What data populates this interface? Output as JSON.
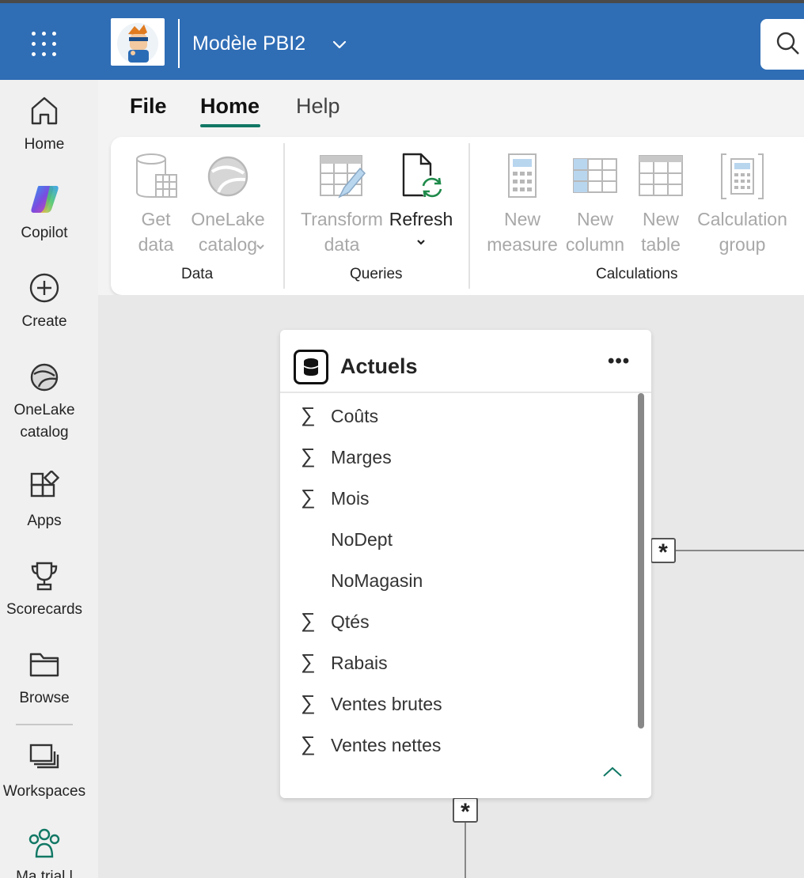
{
  "header": {
    "workspace_title": "Modèle PBI2",
    "icons": [
      "app-launcher-icon",
      "avatar",
      "chevron-down-icon",
      "search-icon"
    ]
  },
  "leftnav": {
    "items": [
      {
        "label": "Home",
        "icon": "home-icon"
      },
      {
        "label": "Copilot",
        "icon": "copilot-icon"
      },
      {
        "label": "Create",
        "icon": "plus-circle-icon"
      },
      {
        "label": "OneLake\ncatalog",
        "icon": "onelake-icon"
      },
      {
        "label": "Apps",
        "icon": "apps-icon"
      },
      {
        "label": "Scorecards",
        "icon": "trophy-icon"
      },
      {
        "label": "Browse",
        "icon": "folder-icon"
      },
      {
        "label": "Workspaces",
        "icon": "workspaces-icon"
      },
      {
        "label": "Ma trial l",
        "icon": "people-icon"
      }
    ]
  },
  "ribbon": {
    "tabs": [
      "File",
      "Home",
      "Help"
    ],
    "active_tab": "Home",
    "groups": [
      {
        "label": "Data",
        "buttons": [
          {
            "line1": "Get",
            "line2": "data",
            "enabled": false
          },
          {
            "line1": "OneLake",
            "line2": "catalog",
            "enabled": false
          }
        ]
      },
      {
        "label": "Queries",
        "buttons": [
          {
            "line1": "Transform",
            "line2": "data",
            "enabled": false
          },
          {
            "line1": "Refresh",
            "line2": "",
            "enabled": true
          }
        ]
      },
      {
        "label": "Calculations",
        "buttons": [
          {
            "line1": "New",
            "line2": "measure",
            "enabled": false
          },
          {
            "line1": "New",
            "line2": "column",
            "enabled": false
          },
          {
            "line1": "New",
            "line2": "table",
            "enabled": false
          },
          {
            "line1": "Calculation",
            "line2": "group",
            "enabled": false
          }
        ]
      }
    ]
  },
  "table_card": {
    "title": "Actuels",
    "more": "•••",
    "fields": [
      {
        "name": "Coûts",
        "sigma": "∑"
      },
      {
        "name": "Marges",
        "sigma": "∑"
      },
      {
        "name": "Mois",
        "sigma": "∑"
      },
      {
        "name": "NoDept",
        "sigma": ""
      },
      {
        "name": "NoMagasin",
        "sigma": ""
      },
      {
        "name": "Qtés",
        "sigma": "∑"
      },
      {
        "name": "Rabais",
        "sigma": "∑"
      },
      {
        "name": "Ventes brutes",
        "sigma": "∑"
      },
      {
        "name": "Ventes nettes",
        "sigma": "∑"
      }
    ]
  },
  "relationships": {
    "right_card": "*",
    "bottom_card": "*"
  },
  "colors": {
    "topbar": "#2f6db5",
    "accent": "#117865",
    "disabled_text": "#a8a8a8"
  }
}
